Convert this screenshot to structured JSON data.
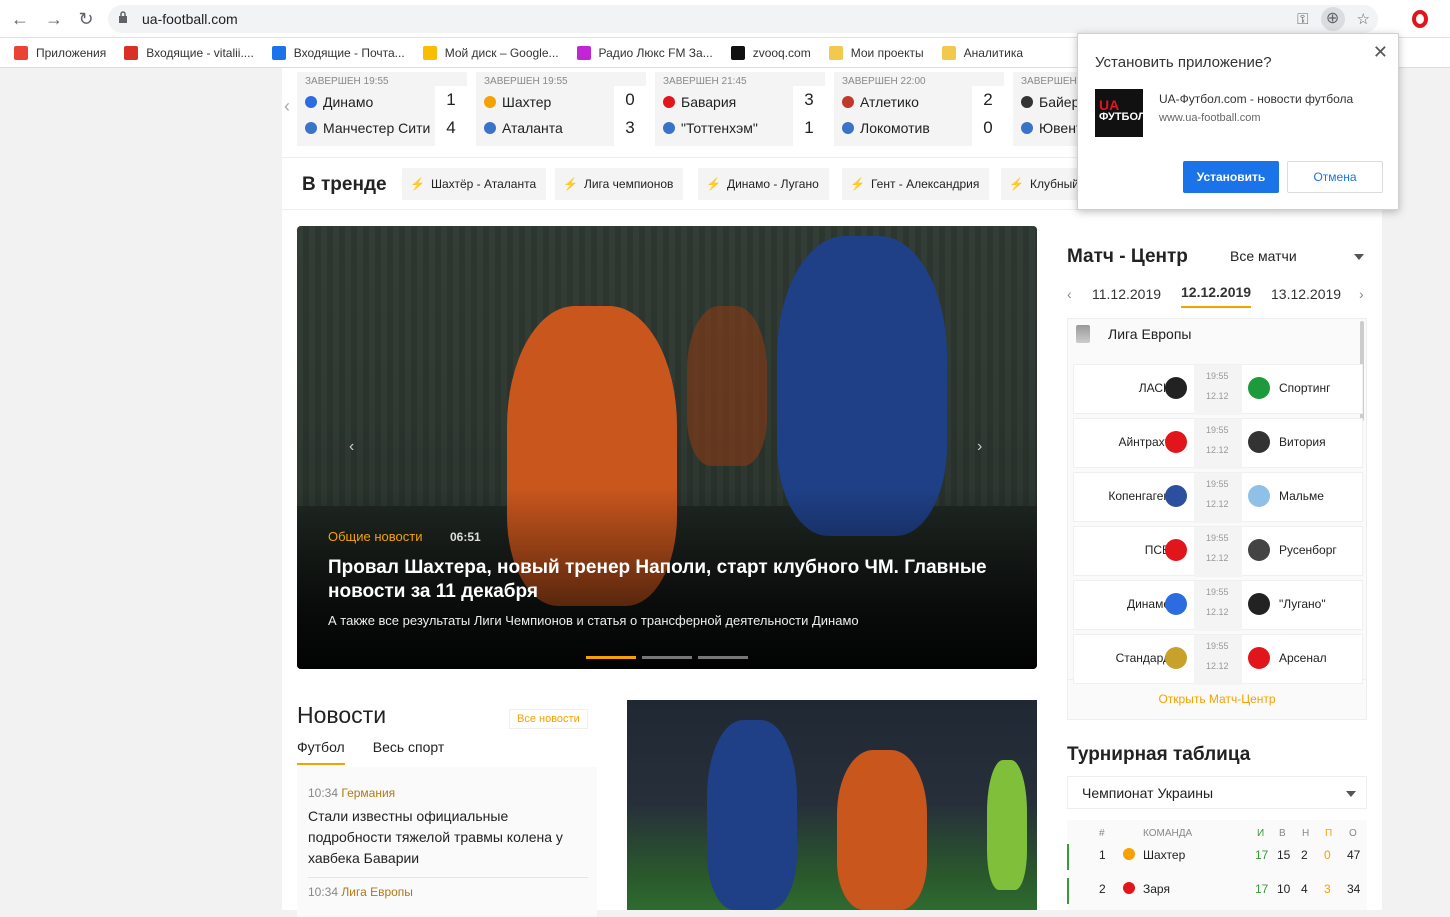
{
  "browser": {
    "url": "ua-football.com",
    "bookmarks": [
      {
        "label": "Приложения",
        "color": "#ea4335"
      },
      {
        "label": "Входящие - vitalii....",
        "color": "#d93025"
      },
      {
        "label": "Входящие - Почта...",
        "color": "#1a73e8"
      },
      {
        "label": "Мой диск – Google...",
        "color": "#fbbc04"
      },
      {
        "label": "Радио Люкс FM За...",
        "color": "#c026d3"
      },
      {
        "label": "zvooq.com",
        "color": "#111111"
      },
      {
        "label": "Мои проекты",
        "color": "#f2c94c"
      },
      {
        "label": "Аналитика",
        "color": "#f2c94c"
      }
    ]
  },
  "scores": [
    {
      "status": "ЗАВЕРШЕН 19:55",
      "home": "Динамо",
      "away": "Манчестер Сити",
      "home_score": "1",
      "away_score": "4"
    },
    {
      "status": "ЗАВЕРШЕН 19:55",
      "home": "Шахтер",
      "away": "Аталанта",
      "home_score": "0",
      "away_score": "3"
    },
    {
      "status": "ЗАВЕРШЕН 21:45",
      "home": "Бавария",
      "away": "\"Тоттенхэм\"",
      "home_score": "3",
      "away_score": "1"
    },
    {
      "status": "ЗАВЕРШЕН 22:00",
      "home": "Атлетико",
      "away": "Локомотив",
      "home_score": "2",
      "away_score": "0"
    },
    {
      "status": "ЗАВЕРШЕН 2",
      "home": "Байер",
      "away": "Ювент",
      "home_score": "",
      "away_score": ""
    }
  ],
  "trend": {
    "title": "В тренде",
    "chips": [
      "Шахтёр - Аталанта",
      "Лига чемпионов",
      "Динамо - Лугано",
      "Гент - Александрия",
      "Клубный"
    ]
  },
  "hero": {
    "category": "Общие новости",
    "time": "06:51",
    "headline": "Провал Шахтера, новый тренер Наполи, старт клубного ЧМ. Главные новости за 11 декабря",
    "subtitle": "А также все результаты Лиги Чемпионов и статья о трансферной деятельности Динамо"
  },
  "news": {
    "title": "Новости",
    "all_link": "Все новости",
    "tabs": [
      "Футбол",
      "Весь спорт"
    ],
    "items": [
      {
        "time": "10:34",
        "tag": "Германия",
        "title": "Стали известны официальные подробности тяжелой травмы колена у хавбека Баварии"
      },
      {
        "time": "10:34",
        "tag": "Лига Европы",
        "title": ""
      }
    ]
  },
  "match_center": {
    "title": "Матч - Центр",
    "filter": "Все матчи",
    "dates": [
      "11.12.2019",
      "12.12.2019",
      "13.12.2019"
    ],
    "league": "Лига Европы",
    "matches": [
      {
        "home": "ЛАСК",
        "away": "Спортинг",
        "time": "19:55",
        "date": "12.12",
        "home_color": "#222222",
        "away_color": "#1c9a3c"
      },
      {
        "home": "Айнтрахт",
        "away": "Витория",
        "time": "19:55",
        "date": "12.12",
        "home_color": "#e2141c",
        "away_color": "#333333"
      },
      {
        "home": "Копенгаген",
        "away": "Мальме",
        "time": "19:55",
        "date": "12.12",
        "home_color": "#2d4fa0",
        "away_color": "#8fc1e8"
      },
      {
        "home": "ПСВ",
        "away": "Русенборг",
        "time": "19:55",
        "date": "12.12",
        "home_color": "#e2141c",
        "away_color": "#444444"
      },
      {
        "home": "Динамо",
        "away": "\"Лугано\"",
        "time": "19:55",
        "date": "12.12",
        "home_color": "#2d6be0",
        "away_color": "#222222"
      },
      {
        "home": "Стандард",
        "away": "Арсенал",
        "time": "19:55",
        "date": "12.12",
        "home_color": "#c7a12a",
        "away_color": "#e2141c"
      }
    ],
    "open_link": "Открыть Матч-Центр"
  },
  "table": {
    "title": "Турнирная таблица",
    "selected": "Чемпионат Украины",
    "headers": [
      "#",
      "КОМАНДА",
      "И",
      "В",
      "Н",
      "П",
      "О"
    ],
    "rows": [
      {
        "pos": "1",
        "team": "Шахтер",
        "p": "17",
        "w": "15",
        "d": "2",
        "l": "0",
        "pts": "47"
      },
      {
        "pos": "2",
        "team": "Заря",
        "p": "17",
        "w": "10",
        "d": "4",
        "l": "3",
        "pts": "34"
      }
    ]
  },
  "install_popup": {
    "title": "Установить приложение?",
    "app_name": "UA-Футбол.com - новости футбола",
    "app_url": "www.ua-football.com",
    "logo_top": "UA",
    "logo_bottom": "ФУТБОЛ",
    "install": "Установить",
    "cancel": "Отмена"
  }
}
